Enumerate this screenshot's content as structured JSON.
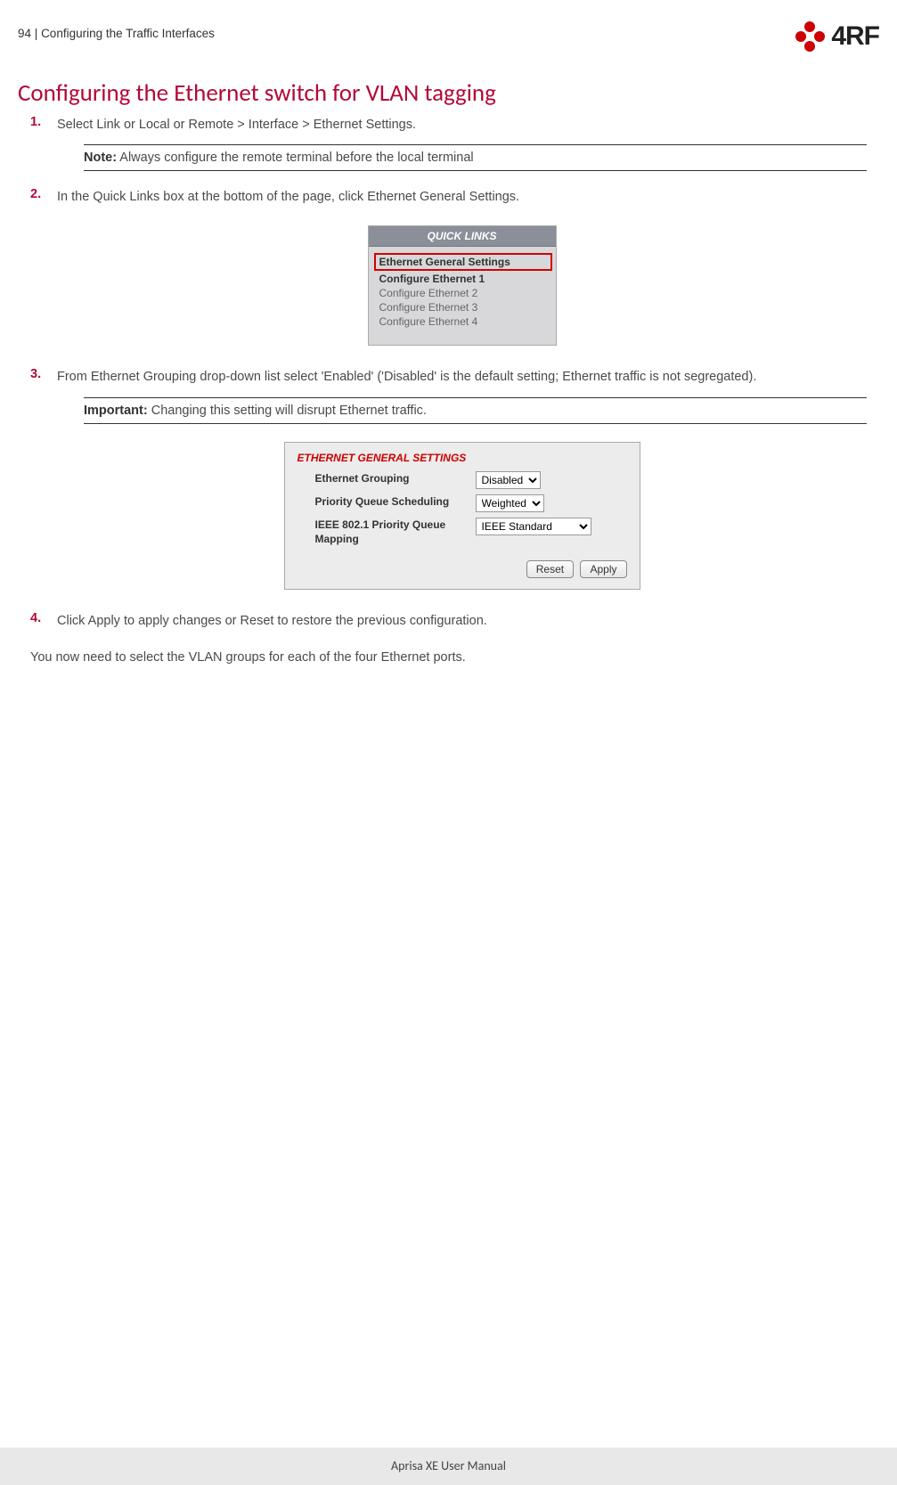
{
  "header": {
    "pageNumber": "94",
    "sectionTitle": "Configuring the Traffic Interfaces",
    "logoText": "4RF"
  },
  "title": "Configuring the Ethernet switch for VLAN tagging",
  "steps": {
    "s1": {
      "num": "1.",
      "text": "Select Link or Local or Remote > Interface > Ethernet Settings."
    },
    "s1_note_label": "Note:",
    "s1_note_text": " Always configure the remote terminal before the local terminal",
    "s2": {
      "num": "2.",
      "text": "In the Quick Links box at the bottom of the page, click Ethernet General Settings."
    },
    "s3": {
      "num": "3.",
      "text": "From Ethernet Grouping drop-down list select 'Enabled' ('Disabled' is the default setting; Ethernet traffic is not segregated)."
    },
    "s3_imp_label": "Important:",
    "s3_imp_text": " Changing this setting will disrupt Ethernet traffic.",
    "s4": {
      "num": "4.",
      "text": "Click Apply to apply changes or Reset to restore the previous configuration."
    }
  },
  "quickLinks": {
    "header": "QUICK LINKS",
    "rows": [
      "Ethernet General Settings",
      "Configure Ethernet 1",
      "Configure Ethernet 2",
      "Configure Ethernet 3",
      "Configure Ethernet 4"
    ]
  },
  "egen": {
    "title": "ETHERNET GENERAL SETTINGS",
    "rows": {
      "grouping_label": "Ethernet Grouping",
      "grouping_value": "Disabled",
      "pqs_label": "Priority Queue Scheduling",
      "pqs_value": "Weighted",
      "pqm_label": "IEEE 802.1 Priority Queue Mapping",
      "pqm_value": "IEEE Standard"
    },
    "buttons": {
      "reset": "Reset",
      "apply": "Apply"
    }
  },
  "closing": "You now need to select the VLAN groups for each of the four Ethernet ports.",
  "footer": "Aprisa XE User Manual"
}
